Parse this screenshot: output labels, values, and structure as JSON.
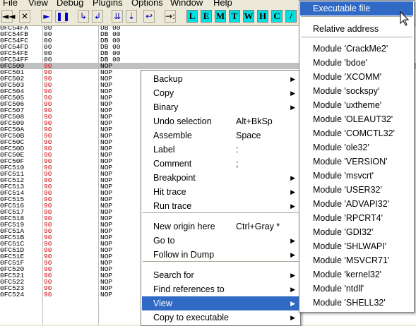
{
  "menubar": [
    "File",
    "View",
    "Debug",
    "Plugins",
    "Options",
    "Window",
    "Help"
  ],
  "toolbar": {
    "nav": [
      "◄◄",
      "✕"
    ],
    "run": [
      "►",
      "❚❚"
    ],
    "step": [
      "↳",
      "↲",
      "⇊",
      "⇣",
      "↩"
    ],
    "goto": "→:",
    "letters": [
      "L",
      "E",
      "M",
      "T",
      "W",
      "H",
      "C",
      "/"
    ]
  },
  "disasm": {
    "rows": [
      {
        "addr": "0FC54FA",
        "hex": "00",
        "instr": "DB 00"
      },
      {
        "addr": "0FC54FB",
        "hex": "00",
        "instr": "DB 00"
      },
      {
        "addr": "0FC54FC",
        "hex": "00",
        "instr": "DB 00"
      },
      {
        "addr": "0FC54FD",
        "hex": "00",
        "instr": "DB 00"
      },
      {
        "addr": "0FC54FE",
        "hex": "00",
        "instr": "DB 00"
      },
      {
        "addr": "0FC54FF",
        "hex": "00",
        "instr": "DB 00"
      },
      {
        "addr": "0FC500",
        "hex": "90",
        "instr": "NOP"
      },
      {
        "addr": "0FC501",
        "hex": "90",
        "instr": "NOP"
      },
      {
        "addr": "0FC502",
        "hex": "90",
        "instr": "NOP"
      },
      {
        "addr": "0FC503",
        "hex": "90",
        "instr": "NOP"
      },
      {
        "addr": "0FC504",
        "hex": "90",
        "instr": "NOP"
      },
      {
        "addr": "0FC505",
        "hex": "90",
        "instr": "NOP"
      },
      {
        "addr": "0FC506",
        "hex": "90",
        "instr": "NOP"
      },
      {
        "addr": "0FC507",
        "hex": "90",
        "instr": "NOP"
      },
      {
        "addr": "0FC508",
        "hex": "90",
        "instr": "NOP"
      },
      {
        "addr": "0FC509",
        "hex": "90",
        "instr": "NOP"
      },
      {
        "addr": "0FC50A",
        "hex": "90",
        "instr": "NOP"
      },
      {
        "addr": "0FC50B",
        "hex": "90",
        "instr": "NOP"
      },
      {
        "addr": "0FC50C",
        "hex": "90",
        "instr": "NOP"
      },
      {
        "addr": "0FC50D",
        "hex": "90",
        "instr": "NOP"
      },
      {
        "addr": "0FC50E",
        "hex": "90",
        "instr": "NOP"
      },
      {
        "addr": "0FC50F",
        "hex": "90",
        "instr": "NOP"
      },
      {
        "addr": "0FC510",
        "hex": "90",
        "instr": "NOP"
      },
      {
        "addr": "0FC511",
        "hex": "90",
        "instr": "NOP"
      },
      {
        "addr": "0FC512",
        "hex": "90",
        "instr": "NOP"
      },
      {
        "addr": "0FC513",
        "hex": "90",
        "instr": "NOP"
      },
      {
        "addr": "0FC514",
        "hex": "90",
        "instr": "NOP"
      },
      {
        "addr": "0FC515",
        "hex": "90",
        "instr": "NOP"
      },
      {
        "addr": "0FC516",
        "hex": "90",
        "instr": "NOP"
      },
      {
        "addr": "0FC517",
        "hex": "90",
        "instr": "NOP"
      },
      {
        "addr": "0FC518",
        "hex": "90",
        "instr": "NOP"
      },
      {
        "addr": "0FC519",
        "hex": "90",
        "instr": "NOP"
      },
      {
        "addr": "0FC51A",
        "hex": "90",
        "instr": "NOP"
      },
      {
        "addr": "0FC51B",
        "hex": "90",
        "instr": "NOP"
      },
      {
        "addr": "0FC51C",
        "hex": "90",
        "instr": "NOP"
      },
      {
        "addr": "0FC51D",
        "hex": "90",
        "instr": "NOP"
      },
      {
        "addr": "0FC51E",
        "hex": "90",
        "instr": "NOP"
      },
      {
        "addr": "0FC51F",
        "hex": "90",
        "instr": "NOP"
      },
      {
        "addr": "0FC520",
        "hex": "90",
        "instr": "NOP"
      },
      {
        "addr": "0FC521",
        "hex": "90",
        "instr": "NOP"
      },
      {
        "addr": "0FC522",
        "hex": "90",
        "instr": "NOP"
      },
      {
        "addr": "0FC523",
        "hex": "90",
        "instr": "NOP"
      },
      {
        "addr": "0FC524",
        "hex": "90",
        "instr": "NOP"
      }
    ]
  },
  "context_menu": {
    "items": [
      {
        "label": "Backup",
        "shortcut": "",
        "submenu": true
      },
      {
        "label": "Copy",
        "shortcut": "",
        "submenu": true
      },
      {
        "label": "Binary",
        "shortcut": "",
        "submenu": true
      },
      {
        "label": "Undo selection",
        "shortcut": "Alt+BkSp",
        "submenu": false
      },
      {
        "label": "Assemble",
        "shortcut": "Space",
        "submenu": false
      },
      {
        "label": "Label",
        "shortcut": ":",
        "submenu": false
      },
      {
        "label": "Comment",
        "shortcut": ";",
        "submenu": false
      },
      {
        "label": "Breakpoint",
        "shortcut": "",
        "submenu": true
      },
      {
        "label": "Hit trace",
        "shortcut": "",
        "submenu": true
      },
      {
        "label": "Run trace",
        "shortcut": "",
        "submenu": true
      },
      {
        "label": "New origin here",
        "shortcut": "Ctrl+Gray *",
        "submenu": false
      },
      {
        "label": "Go to",
        "shortcut": "",
        "submenu": true
      },
      {
        "label": "Follow in Dump",
        "shortcut": "",
        "submenu": true
      },
      {
        "label": "Search for",
        "shortcut": "",
        "submenu": true
      },
      {
        "label": "Find references to",
        "shortcut": "",
        "submenu": true
      },
      {
        "label": "View",
        "shortcut": "",
        "submenu": true
      },
      {
        "label": "Copy to executable",
        "shortcut": "",
        "submenu": true
      }
    ]
  },
  "view_submenu": {
    "items": [
      "Executable file",
      "Relative address",
      "Module 'CrackMe2'",
      "Module 'bdoe'",
      "Module 'XCOMM'",
      "Module 'sockspy'",
      "Module 'uxtheme'",
      "Module 'OLEAUT32'",
      "Module 'COMCTL32'",
      "Module 'ole32'",
      "Module 'VERSION'",
      "Module 'msvcrt'",
      "Module 'USER32'",
      "Module 'ADVAPI32'",
      "Module 'RPCRT4'",
      "Module 'GDI32'",
      "Module 'SHLWAPI'",
      "Module 'MSVCR71'",
      "Module 'kernel32'",
      "Module 'ntdll'",
      "Module 'SHELL32'"
    ]
  },
  "colors": {
    "highlight": "#316ac5",
    "opcode_red": "#d00000",
    "letter_button": "#00e0e0"
  }
}
